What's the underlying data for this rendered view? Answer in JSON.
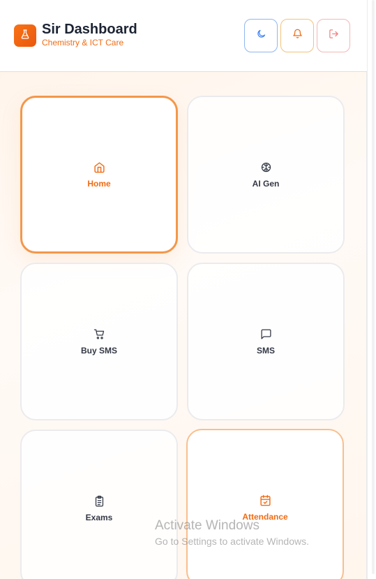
{
  "header": {
    "title": "Sir Dashboard",
    "subtitle": "Chemistry & ICT Care",
    "logo_icon": "flask-icon",
    "buttons": [
      {
        "name": "theme-toggle-button",
        "icon": "moon-icon",
        "color": "#3b82f6"
      },
      {
        "name": "notifications-button",
        "icon": "bell-icon",
        "color": "#f26b12"
      },
      {
        "name": "logout-button",
        "icon": "logout-icon",
        "color": "#f08080"
      }
    ]
  },
  "tiles": [
    {
      "label": "Home",
      "icon": "home-icon",
      "state": "active"
    },
    {
      "label": "AI Gen",
      "icon": "brain-icon",
      "state": "normal"
    },
    {
      "label": "Buy SMS",
      "icon": "cart-icon",
      "state": "normal"
    },
    {
      "label": "SMS",
      "icon": "message-icon",
      "state": "normal"
    },
    {
      "label": "Exams",
      "icon": "clipboard-icon",
      "state": "normal"
    },
    {
      "label": "Attendance",
      "icon": "calendar-check-icon",
      "state": "highlight"
    }
  ],
  "watermark": {
    "title": "Activate Windows",
    "subtitle": "Go to Settings to activate Windows."
  },
  "colors": {
    "accent": "#f26b12",
    "active_border": "#f4974a",
    "text": "#1c2333"
  }
}
